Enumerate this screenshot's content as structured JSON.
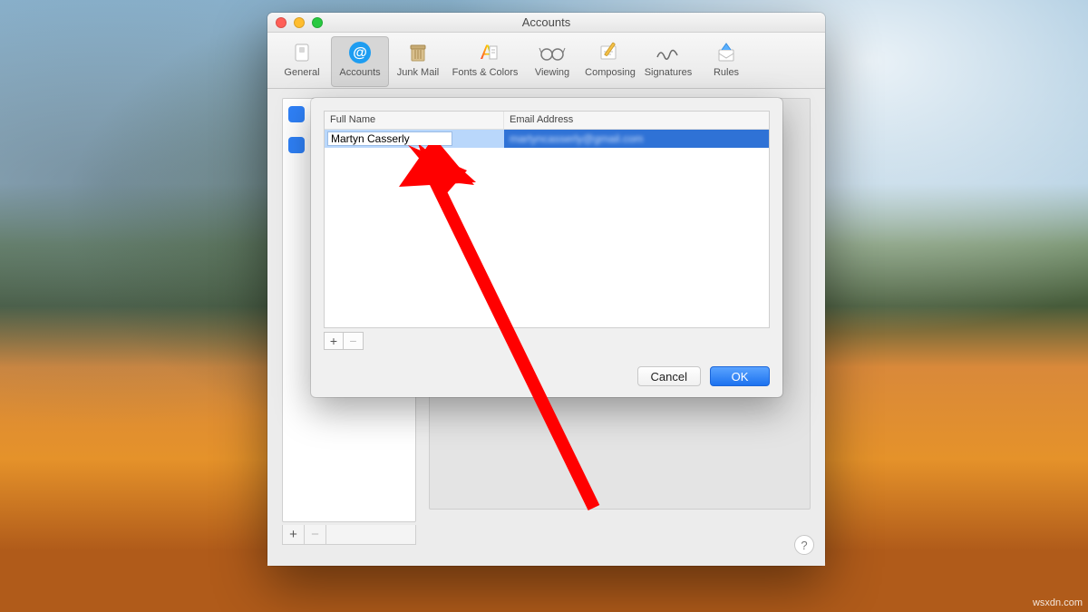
{
  "watermark": "wsxdn.com",
  "window": {
    "title": "Accounts",
    "toolbar": {
      "general": "General",
      "accounts": "Accounts",
      "junk": "Junk Mail",
      "fonts": "Fonts & Colors",
      "viewing": "Viewing",
      "composing": "Composing",
      "signatures": "Signatures",
      "rules": "Rules",
      "selected": "accounts"
    },
    "side_add": "+",
    "side_remove": "−",
    "help": "?"
  },
  "sheet": {
    "headers": {
      "col1": "Full Name",
      "col2": "Email Address"
    },
    "row": {
      "full_name": "Martyn Casserly",
      "email_blurred": "martyncasserly@gmail.com"
    },
    "add": "+",
    "remove": "−",
    "cancel": "Cancel",
    "ok": "OK"
  },
  "colors": {
    "accent": "#1c72ef",
    "arrow": "#ff0000"
  }
}
